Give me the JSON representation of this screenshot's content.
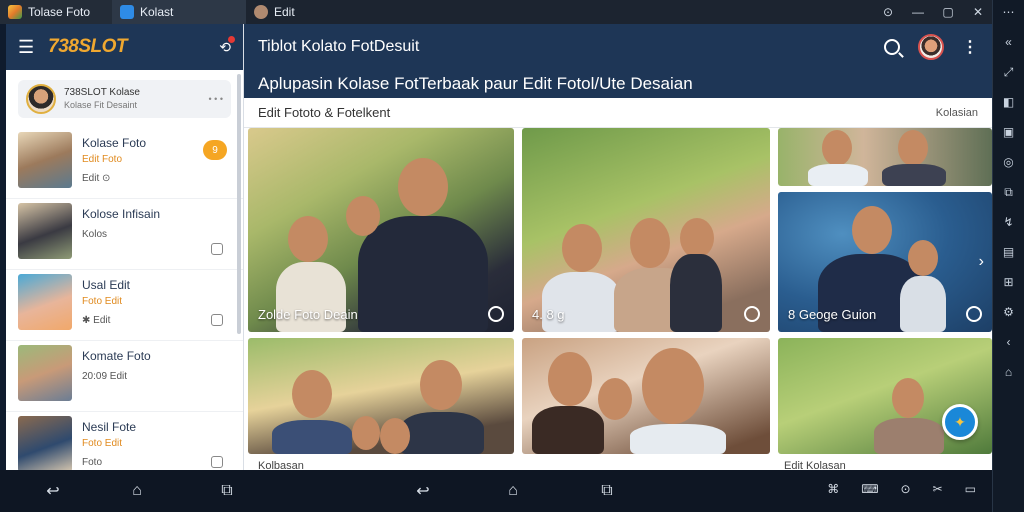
{
  "titlebar": {
    "tabs": [
      {
        "label": "Tolase Foto"
      },
      {
        "label": "Kolast"
      },
      {
        "label": "Edit"
      }
    ]
  },
  "sidebar": {
    "logo": "738SLOT",
    "profile": {
      "name": "738SLOT Kolase",
      "sub": "Kolase Fit Desaint",
      "more": "• • •"
    },
    "items": [
      {
        "title": "Kolase Foto",
        "sub": "Edit Foto",
        "meta": "Edit ⊙",
        "badge": "9"
      },
      {
        "title": "Kolose Infisain",
        "sub": "",
        "meta": "Kolos"
      },
      {
        "title": "Usal Edit",
        "sub": "Foto Edit",
        "meta": "✱ Edit"
      },
      {
        "title": "Komate Foto",
        "sub": "",
        "meta": "20:09 Edit"
      },
      {
        "title": "Nesil Fote",
        "sub": "Foto Edit",
        "meta": "Foto"
      }
    ]
  },
  "main": {
    "title": "Tiblot Kolato FotDesuit",
    "subheading": "Aplupasin Kolase FotTerbaak paur Edit Fotol/Ute Desaian",
    "filter_left": "Edit Fototo & Fotelkent",
    "filter_right": "Kolasian",
    "photos": [
      {
        "caption": "Zolde Foto Deain"
      },
      {
        "caption": "4. 8 g"
      },
      {
        "caption": ""
      },
      {
        "caption": "8 Geoge Guion"
      },
      {
        "caption": ""
      },
      {
        "caption": ""
      },
      {
        "caption": ""
      }
    ],
    "labels_below": {
      "left": "Kolbasan",
      "right": "Edit Kolasan"
    }
  },
  "colors": {
    "header": "#1e3656",
    "accent": "#f0a830",
    "fab": "#1a88d8"
  }
}
